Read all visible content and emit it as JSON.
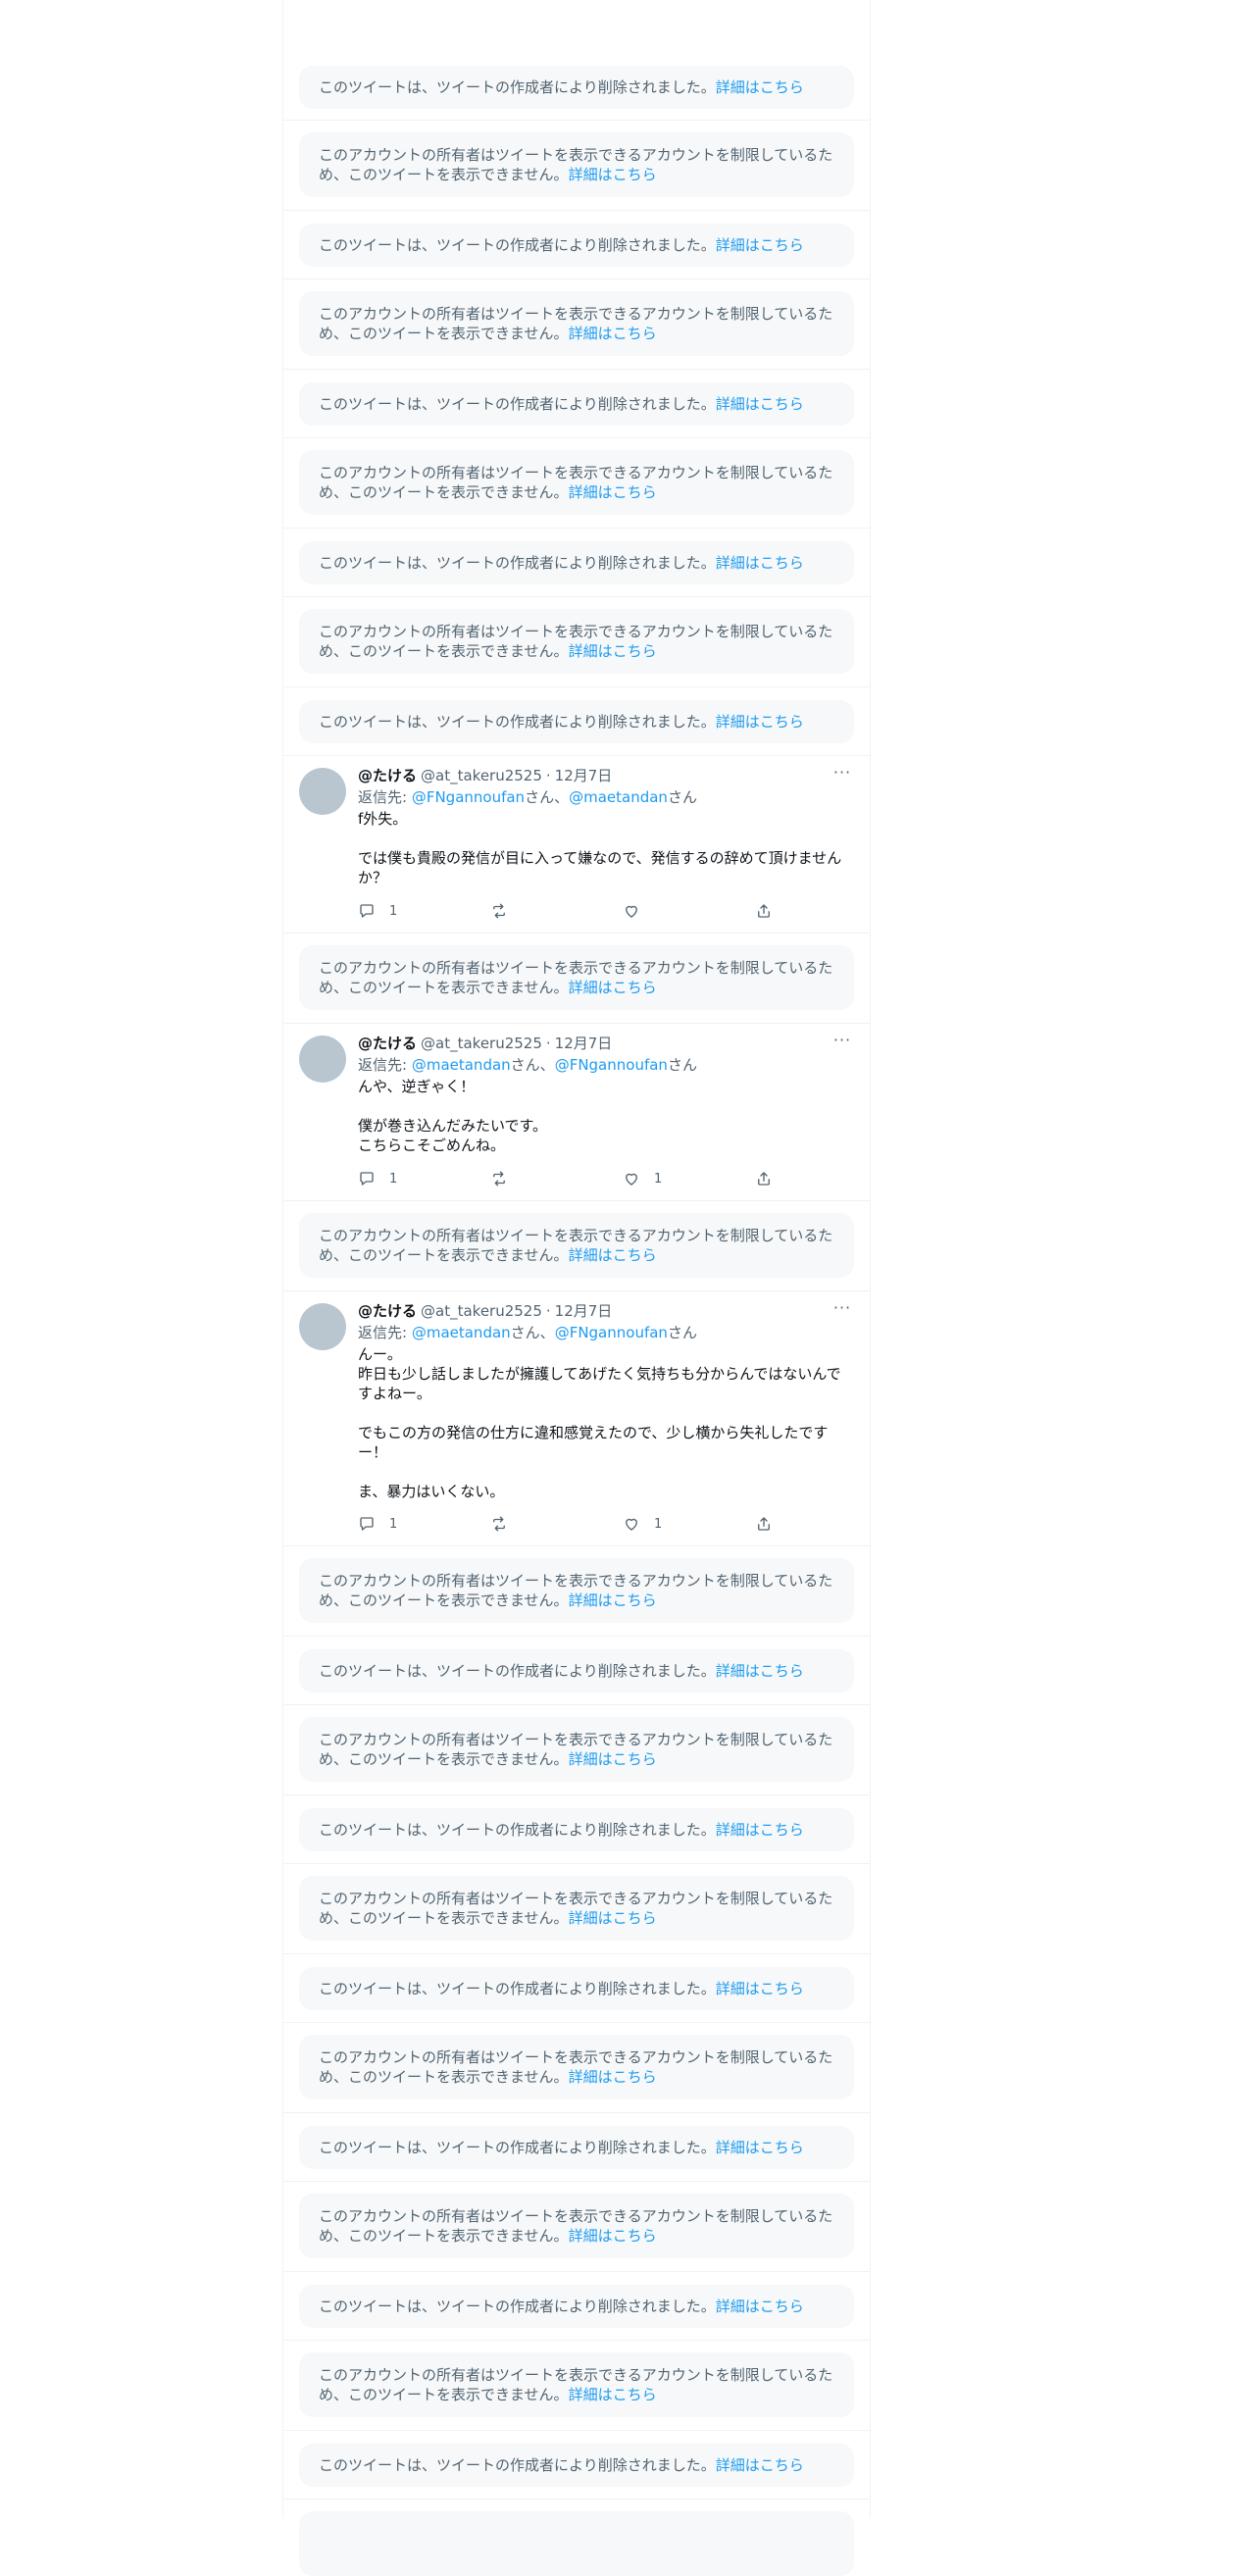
{
  "deleted_notice": {
    "text": "このツイートは、ツイートの作成者により削除されました。",
    "link": "詳細はこちら"
  },
  "restricted_notice": {
    "line1": "このアカウントの所有者はツイートを表示できるアカウントを制限しているた",
    "line2": "め、このツイートを表示できません。",
    "link": "詳細はこちら"
  },
  "tweets": [
    {
      "display_name": "@たける",
      "handle": "@at_takeru2525",
      "dot": "·",
      "time": "12月7日",
      "reply_prefix": "返信先: ",
      "mention1": "@FNgannoufan",
      "suffix1": "さん、",
      "mention2": "@maetandan",
      "suffix2": "さん",
      "text": "f外失。\n\nでは僕も貴殿の発信が目に入って嫌なので、発信するの辞めて頂けませんか？",
      "reply_count": "1",
      "retweet_count": "",
      "like_count": ""
    },
    {
      "display_name": "@たける",
      "handle": "@at_takeru2525",
      "dot": "·",
      "time": "12月7日",
      "reply_prefix": "返信先: ",
      "mention1": "@maetandan",
      "suffix1": "さん、",
      "mention2": "@FNgannoufan",
      "suffix2": "さん",
      "text": "んや、逆ぎゃく！\n\n僕が巻き込んだみたいです。\nこちらこそごめんね。",
      "reply_count": "1",
      "retweet_count": "",
      "like_count": "1"
    },
    {
      "display_name": "@たける",
      "handle": "@at_takeru2525",
      "dot": "·",
      "time": "12月7日",
      "reply_prefix": "返信先: ",
      "mention1": "@maetandan",
      "suffix1": "さん、",
      "mention2": "@FNgannoufan",
      "suffix2": "さん",
      "text": "んー。\n昨日も少し話しましたが擁護してあげたく気持ちも分からんではないんですよねー。\n\nでもこの方の発信の仕方に違和感覚えたので、少し横から失礼したですー！\n\nま、暴力はいくない。",
      "reply_count": "1",
      "retweet_count": "",
      "like_count": "1"
    }
  ]
}
